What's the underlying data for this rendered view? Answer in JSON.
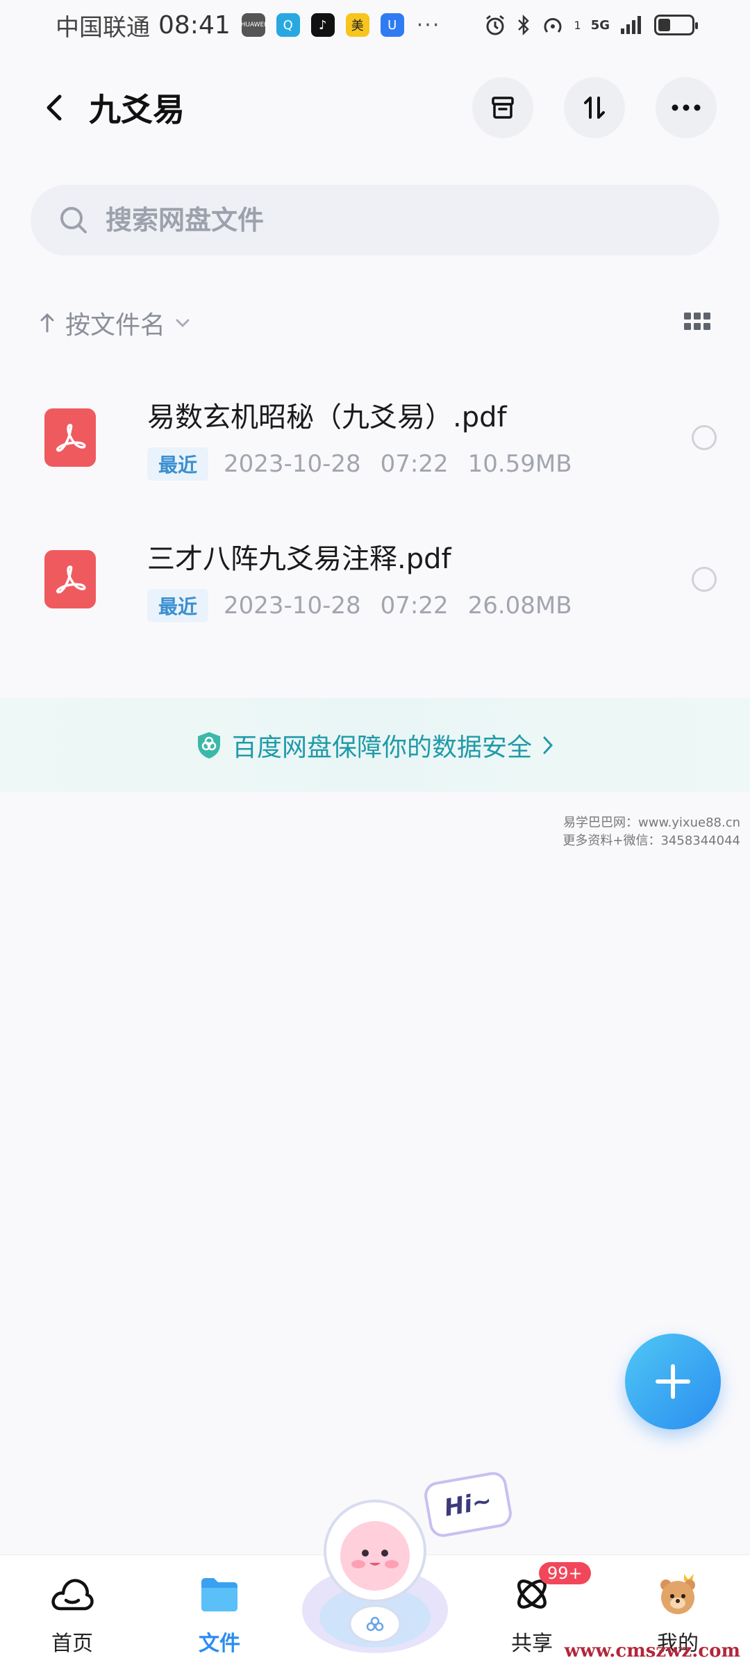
{
  "status_bar": {
    "carrier": "中国联通",
    "time": "08:41",
    "apps": [
      {
        "icon": "huawei-store-icon",
        "color": "#555555",
        "label": "HUAWEI"
      },
      {
        "icon": "search-app-icon",
        "color": "#28a8e0",
        "label": "Q"
      },
      {
        "icon": "tiktok-icon",
        "color": "#111111",
        "label": "♪"
      },
      {
        "icon": "meituan-icon",
        "color": "#f7c51e",
        "label": "美"
      },
      {
        "icon": "shield-app-icon",
        "color": "#2f7cf2",
        "label": "U"
      }
    ],
    "more": "···",
    "network": "5G",
    "sim": "1"
  },
  "header": {
    "title": "九爻易"
  },
  "search": {
    "placeholder": "搜索网盘文件"
  },
  "sort": {
    "label": "按文件名"
  },
  "files": [
    {
      "name": "易数玄机昭秘（九爻易）.pdf",
      "tag": "最近",
      "date": "2023-10-28",
      "time": "07:22",
      "size": "10.59MB"
    },
    {
      "name": "三才八阵九爻易注释.pdf",
      "tag": "最近",
      "date": "2023-10-28",
      "time": "07:22",
      "size": "26.08MB"
    }
  ],
  "security_banner": {
    "text": "百度网盘保障你的数据安全"
  },
  "watermark": {
    "line1": "易学巴巴网：www.yixue88.cn",
    "line2": "更多资料+微信：3458344044"
  },
  "mascot": {
    "greeting": "Hi~"
  },
  "bottom_nav": {
    "items": [
      {
        "label": "首页",
        "icon": "cloud-home-icon"
      },
      {
        "label": "文件",
        "icon": "folder-icon",
        "active": true
      },
      {
        "label": "共享",
        "icon": "share-orbit-icon",
        "badge": "99+"
      },
      {
        "label": "我的",
        "icon": "bear-avatar-icon"
      }
    ]
  },
  "site_mark": "www.cmszwz.com",
  "colors": {
    "accent": "#2a8df0",
    "pdf_red": "#ef5a5f",
    "security_teal": "#1f9aa8",
    "badge_red": "#f2475a"
  }
}
